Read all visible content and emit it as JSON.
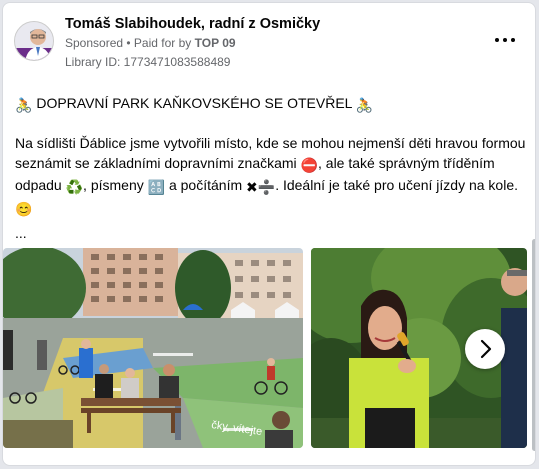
{
  "post": {
    "author": "Tomáš Slabihoudek, radní z Osmičky",
    "sponsored": "Sponsored",
    "paid_for_by_prefix": "• Paid for by",
    "payer": "TOP 09",
    "library_id": "Library ID: 1773471083588489",
    "more_icon": "more-horizontal-icon",
    "headline": "DOPRAVNÍ PARK KAŇKOVSKÉHO SE OTEVŘEL",
    "body": {
      "part1": "Na sídlišti Ďáblice jsme vytvořili místo, kde se mohou nejmenší děti hravou formou seznámit se základními dopravními značkami",
      "part2": ", ale také správným tříděním odpadu",
      "part3": ", písmeny",
      "part4": "a počítáním",
      "part5": ". Ideální je také pro učení jízdy na kole."
    },
    "ellipsis": "...",
    "emoji": {
      "bike": "🚴",
      "no_entry": "⛔",
      "recycle": "♻️",
      "letters": "🔠",
      "multiply": "✖",
      "divide": "➗",
      "smile": "😊"
    },
    "sign_text": "čky, vítejte"
  },
  "carousel": {
    "next_icon": "chevron-right-icon"
  }
}
